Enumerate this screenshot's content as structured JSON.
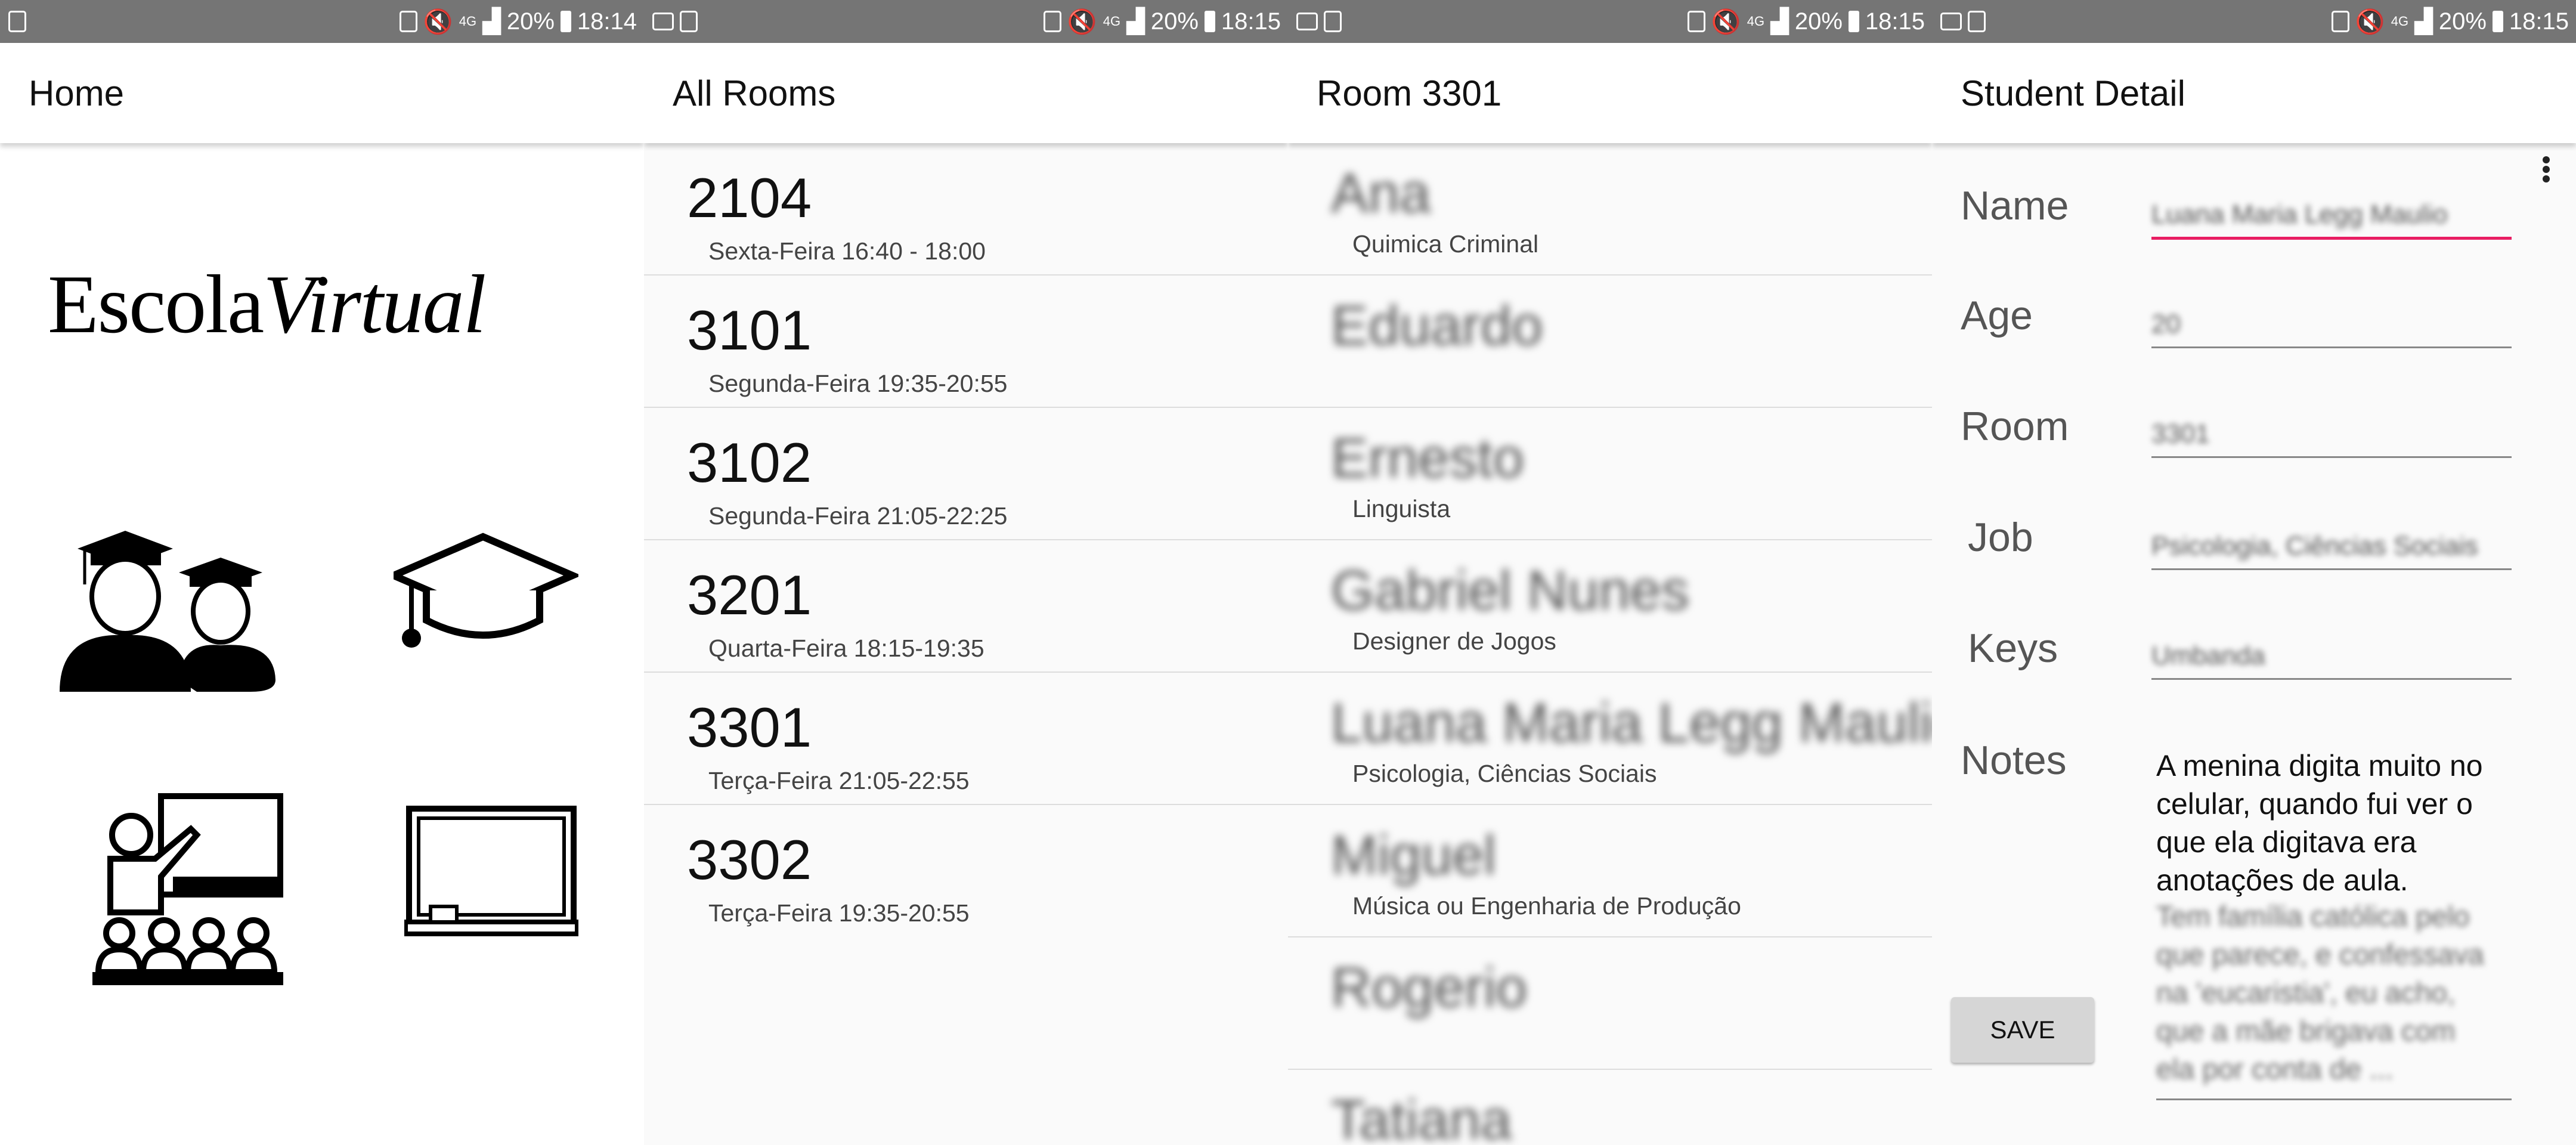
{
  "status_bars": [
    {
      "battery": "20%",
      "time": "18:14"
    },
    {
      "battery": "20%",
      "time": "18:15"
    },
    {
      "battery": "20%",
      "time": "18:15"
    },
    {
      "battery": "20%",
      "time": "18:15"
    }
  ],
  "status_network": "4G",
  "home": {
    "title": "Home",
    "logo_regular": "Escola",
    "logo_italic": "Virtual",
    "icons": [
      "students-icon",
      "graduation-cap-icon",
      "classroom-icon",
      "blackboard-icon"
    ]
  },
  "all_rooms": {
    "title": "All Rooms",
    "rooms": [
      {
        "number": "2104",
        "time": "Sexta-Feira 16:40 - 18:00"
      },
      {
        "number": "3101",
        "time": "Segunda-Feira 19:35-20:55"
      },
      {
        "number": "3102",
        "time": "Segunda-Feira 21:05-22:25"
      },
      {
        "number": "3201",
        "time": "Quarta-Feira 18:15-19:35"
      },
      {
        "number": "3301",
        "time": "Terça-Feira 21:05-22:55"
      },
      {
        "number": "3302",
        "time": "Terça-Feira 19:35-20:55"
      }
    ]
  },
  "room_detail": {
    "title": "Room 3301",
    "students": [
      {
        "name": "Ana",
        "job": "Quimica Criminal"
      },
      {
        "name": "Eduardo",
        "job": ""
      },
      {
        "name": "Ernesto",
        "job": "Linguista"
      },
      {
        "name": "Gabriel Nunes",
        "job": "Designer de Jogos"
      },
      {
        "name": "Luana Maria Legg Maulio",
        "job": "Psicologia, Ciências Sociais"
      },
      {
        "name": "Miguel",
        "job": "Música ou Engenharia de Produção"
      },
      {
        "name": "Rogerio",
        "job": ""
      },
      {
        "name": "Tatiana",
        "job": ""
      }
    ]
  },
  "student_detail": {
    "title": "Student Detail",
    "labels": {
      "name": "Name",
      "age": "Age",
      "room": "Room",
      "job": "Job",
      "keys": "Keys",
      "notes": "Notes"
    },
    "values": {
      "name": "Luana Maria Legg Maulio",
      "age": "20",
      "room": "3301",
      "job": "Psicologia, Ciências Sociais",
      "keys": "Umbanda"
    },
    "notes_visible": "A menina digita muito no celular, quando fui ver o que ela digitava era anotações de aula.",
    "notes_blurred": "Tem família católica pelo que parece, e confessava na 'eucaristia', eu acho, que a mãe brigava com ela por conta de ...",
    "save_label": "SAVE"
  }
}
